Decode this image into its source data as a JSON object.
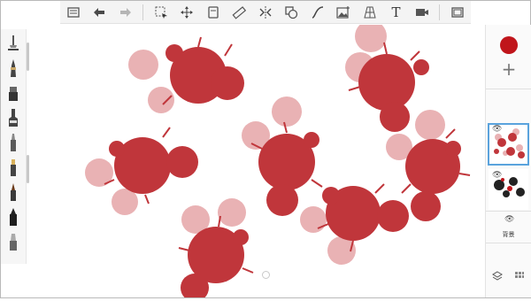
{
  "toolbar": {
    "items": [
      "gallery",
      "undo",
      "redo",
      "select",
      "transform",
      "crop",
      "ruler",
      "symmetry",
      "shape",
      "curve",
      "image",
      "perspective-grid",
      "text",
      "record",
      "fullscreen"
    ],
    "text_tool_glyph": "T"
  },
  "brushes": [
    "pencil",
    "pen",
    "airbrush",
    "marker",
    "brush",
    "chisel",
    "ink",
    "fill",
    "eraser"
  ],
  "right_panel": {
    "current_color": "#c0151b",
    "add_layer_glyph": "+",
    "eye_glyph": "👁",
    "background_label": "背景"
  },
  "colors": {
    "splat_dark": "#c0363b",
    "splat_light": "#e9b2b4"
  }
}
